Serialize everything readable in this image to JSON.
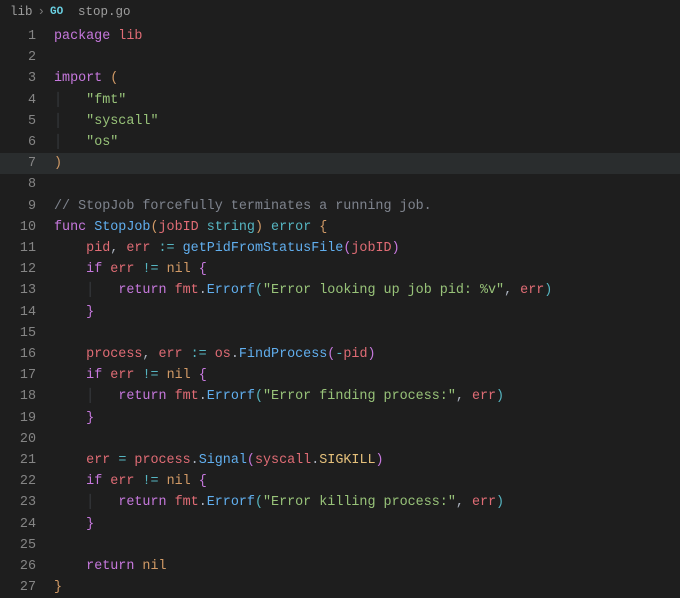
{
  "breadcrumb": {
    "folder": "lib",
    "file": "stop.go"
  },
  "code": {
    "l1": {
      "package": "package",
      "pkg": "lib"
    },
    "l3": {
      "import": "import"
    },
    "l4": {
      "s": "\"fmt\""
    },
    "l5": {
      "s": "\"syscall\""
    },
    "l6": {
      "s": "\"os\""
    },
    "l9": {
      "cmt": "// StopJob forcefully terminates a running job."
    },
    "l10": {
      "func": "func",
      "name": "StopJob",
      "param": "jobID",
      "ptype": "string",
      "rtype": "error"
    },
    "l11": {
      "a": "pid",
      "b": "err",
      "assign": ":=",
      "callfn": "getPidFromStatusFile",
      "arg": "jobID"
    },
    "l12": {
      "if": "if",
      "a": "err",
      "op": "!=",
      "nil": "nil"
    },
    "l13": {
      "return": "return",
      "obj": "fmt",
      "fn": "Errorf",
      "s": "\"Error looking up job pid: %v\"",
      "arg": "err"
    },
    "l16": {
      "a": "process",
      "b": "err",
      "assign": ":=",
      "obj": "os",
      "fn": "FindProcess",
      "minus": "-",
      "arg": "pid"
    },
    "l17": {
      "if": "if",
      "a": "err",
      "op": "!=",
      "nil": "nil"
    },
    "l18": {
      "return": "return",
      "obj": "fmt",
      "fn": "Errorf",
      "s": "\"Error finding process:\"",
      "arg": "err"
    },
    "l21": {
      "a": "err",
      "eq": "=",
      "obj": "process",
      "fn": "Signal",
      "obj2": "syscall",
      "const": "SIGKILL"
    },
    "l22": {
      "if": "if",
      "a": "err",
      "op": "!=",
      "nil": "nil"
    },
    "l23": {
      "return": "return",
      "obj": "fmt",
      "fn": "Errorf",
      "s": "\"Error killing process:\"",
      "arg": "err"
    },
    "l26": {
      "return": "return",
      "nil": "nil"
    }
  }
}
